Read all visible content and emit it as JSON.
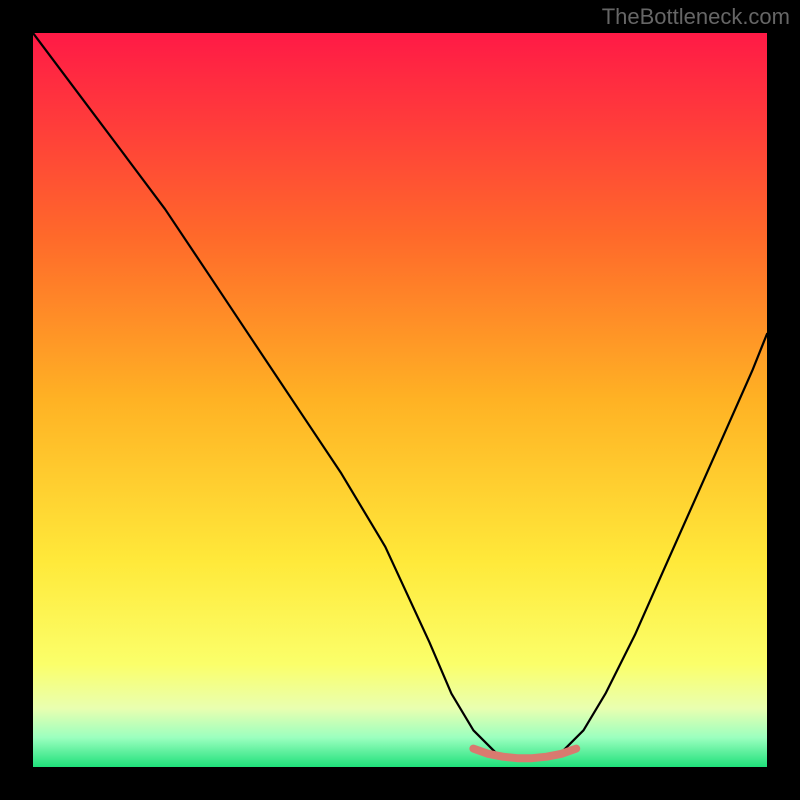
{
  "watermark": "TheBottleneck.com",
  "colors": {
    "frame_border": "#000000",
    "curve_stroke": "#000000",
    "marker_stroke": "#d97a6f",
    "gradient_top": "#ff1a46",
    "gradient_bottom": "#1fe07a"
  },
  "chart_data": {
    "type": "line",
    "title": "",
    "xlabel": "",
    "ylabel": "",
    "xlim": [
      0,
      100
    ],
    "ylim": [
      0,
      100
    ],
    "grid": false,
    "legend": false,
    "series": [
      {
        "name": "bottleneck_curve",
        "x": [
          0,
          6,
          12,
          18,
          24,
          30,
          36,
          42,
          48,
          54,
          57,
          60,
          63,
          66,
          69,
          72,
          75,
          78,
          82,
          86,
          90,
          94,
          98,
          100
        ],
        "y": [
          100,
          92,
          84,
          76,
          67,
          58,
          49,
          40,
          30,
          17,
          10,
          5,
          2,
          1,
          1,
          2,
          5,
          10,
          18,
          27,
          36,
          45,
          54,
          59
        ]
      }
    ],
    "annotations": [
      {
        "name": "optimal_markers",
        "x": [
          60,
          62,
          64,
          66,
          68,
          70,
          72,
          74
        ],
        "y": [
          2.5,
          1.8,
          1.4,
          1.2,
          1.2,
          1.4,
          1.8,
          2.5
        ]
      }
    ]
  }
}
